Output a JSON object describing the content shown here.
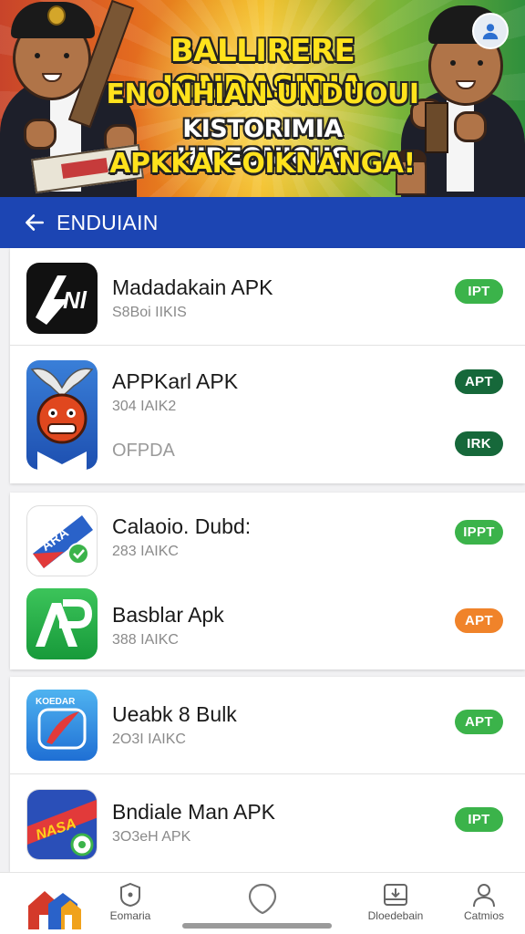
{
  "banner": {
    "line1": "BALLIRERE IGNDASIRIA",
    "line2": "ENONHIAN UNDUOUI",
    "line3": "KISTORIMIA HIDEONIOUS",
    "line4": "APKKAK OIKNANGA!"
  },
  "appbar": {
    "title": "ENDUIAIN"
  },
  "apps": [
    {
      "name": "Madadakain APK",
      "size": "S8Boi IIKIS",
      "button": "IPT",
      "button_color": "#3bb34a"
    },
    {
      "name": "APPKarl APK",
      "size": "304 IAIK2",
      "extra": "OFPDA",
      "button": "APT",
      "button_color": "#16683a",
      "button2": "IRK",
      "button2_color": "#16683a"
    },
    {
      "name": "Calaoio. Dubd:",
      "size": "283 IAIKC",
      "button": "IPPT",
      "button_color": "#3bb34a"
    },
    {
      "name": "Basblar Apk",
      "size": "388 IAIKC",
      "button": "APT",
      "button_color": "#f0832a"
    },
    {
      "name": "Ueabk 8 Bulk",
      "size": "2O3I IAIKC",
      "button": "APT",
      "button_color": "#3bb34a"
    },
    {
      "name": "Bndiale Man APK",
      "size": "3O3eH APK",
      "button": "IPT",
      "button_color": "#3bb34a"
    }
  ],
  "icons": {
    "app1": "lightning-logo-icon",
    "app2": "bird-mascot-icon",
    "app3": "map-pin-icon",
    "app4": "ar-logo-icon",
    "app5": "feather-icon",
    "app6": "map-badge-icon"
  },
  "nav": [
    {
      "label": "",
      "icon": "home-icon"
    },
    {
      "label": "Eomaria",
      "icon": "badge-icon"
    },
    {
      "label": "",
      "icon": "circle-icon"
    },
    {
      "label": "Dloedebain",
      "icon": "download-box-icon"
    },
    {
      "label": "Catmios",
      "icon": "person-icon"
    }
  ],
  "colors": {
    "appbar": "#1c45b3",
    "green": "#3bb34a",
    "dark_green": "#16683a",
    "orange": "#f0832a"
  }
}
